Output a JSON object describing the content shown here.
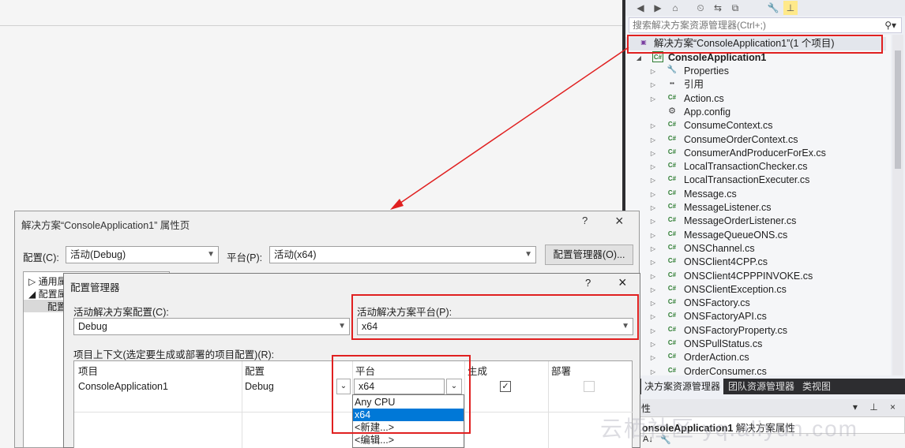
{
  "solution_explorer": {
    "search_placeholder": "搜索解决方案资源管理器(Ctrl+;)",
    "root": "解决方案“ConsoleApplication1”(1 个项目)",
    "project": "ConsoleApplication1",
    "items": [
      {
        "label": "Properties",
        "icon": "wrench-icon",
        "arrow": "▷"
      },
      {
        "label": "引用",
        "icon": "references-icon",
        "arrow": "▷"
      },
      {
        "label": "Action.cs",
        "icon": "csharp-file-icon",
        "arrow": "▷"
      },
      {
        "label": "App.config",
        "icon": "config-file-icon",
        "arrow": ""
      },
      {
        "label": "ConsumeContext.cs",
        "icon": "csharp-file-icon",
        "arrow": "▷"
      },
      {
        "label": "ConsumeOrderContext.cs",
        "icon": "csharp-file-icon",
        "arrow": "▷"
      },
      {
        "label": "ConsumerAndProducerForEx.cs",
        "icon": "csharp-file-icon",
        "arrow": "▷"
      },
      {
        "label": "LocalTransactionChecker.cs",
        "icon": "csharp-file-icon",
        "arrow": "▷"
      },
      {
        "label": "LocalTransactionExecuter.cs",
        "icon": "csharp-file-icon",
        "arrow": "▷"
      },
      {
        "label": "Message.cs",
        "icon": "csharp-file-icon",
        "arrow": "▷"
      },
      {
        "label": "MessageListener.cs",
        "icon": "csharp-file-icon",
        "arrow": "▷"
      },
      {
        "label": "MessageOrderListener.cs",
        "icon": "csharp-file-icon",
        "arrow": "▷"
      },
      {
        "label": "MessageQueueONS.cs",
        "icon": "csharp-file-icon",
        "arrow": "▷"
      },
      {
        "label": "ONSChannel.cs",
        "icon": "csharp-file-icon",
        "arrow": "▷"
      },
      {
        "label": "ONSClient4CPP.cs",
        "icon": "csharp-file-icon",
        "arrow": "▷"
      },
      {
        "label": "ONSClient4CPPPINVOKE.cs",
        "icon": "csharp-file-icon",
        "arrow": "▷"
      },
      {
        "label": "ONSClientException.cs",
        "icon": "csharp-file-icon",
        "arrow": "▷"
      },
      {
        "label": "ONSFactory.cs",
        "icon": "csharp-file-icon",
        "arrow": "▷"
      },
      {
        "label": "ONSFactoryAPI.cs",
        "icon": "csharp-file-icon",
        "arrow": "▷"
      },
      {
        "label": "ONSFactoryProperty.cs",
        "icon": "csharp-file-icon",
        "arrow": "▷"
      },
      {
        "label": "ONSPullStatus.cs",
        "icon": "csharp-file-icon",
        "arrow": "▷"
      },
      {
        "label": "OrderAction.cs",
        "icon": "csharp-file-icon",
        "arrow": "▷"
      },
      {
        "label": "OrderConsumer.cs",
        "icon": "csharp-file-icon",
        "arrow": "▷"
      }
    ],
    "tabs": [
      "决方案资源管理器",
      "团队资源管理器",
      "类视图"
    ],
    "properties_title": "性",
    "properties_selection_bold": "onsoleApplication1",
    "properties_selection_rest": " 解决方案属性",
    "properties_controls": "▾ ⊥ ×"
  },
  "property_pages": {
    "title": "解决方案“ConsoleApplication1” 属性页",
    "help": "?",
    "close": "×",
    "config_label": "配置(C):",
    "config_value": "活动(Debug)",
    "platform_label": "平台(P):",
    "platform_value": "活动(x64)",
    "config_manager_button": "配置管理器(O)...",
    "tree": [
      "通用属",
      "配置属",
      "配置"
    ]
  },
  "config_manager": {
    "title": "配置管理器",
    "help": "?",
    "close": "×",
    "active_config_label": "活动解决方案配置(C):",
    "active_config_value": "Debug",
    "active_platform_label": "活动解决方案平台(P):",
    "active_platform_value": "x64",
    "contexts_label": "项目上下文(选定要生成或部署的项目配置)(R):",
    "columns": [
      "项目",
      "配置",
      "平台",
      "生成",
      "部署"
    ],
    "row": {
      "project": "ConsoleApplication1",
      "config": "Debug",
      "platform": "x64",
      "build": true,
      "deploy": false
    },
    "platform_options": [
      "Any CPU",
      "x64",
      "<新建...>",
      "<编辑...>"
    ],
    "selected_option": "x64"
  },
  "watermark": "云栖社区 yq.aliyun.com",
  "colors": {
    "highlight": "#e02020",
    "selection": "#0078d7"
  }
}
